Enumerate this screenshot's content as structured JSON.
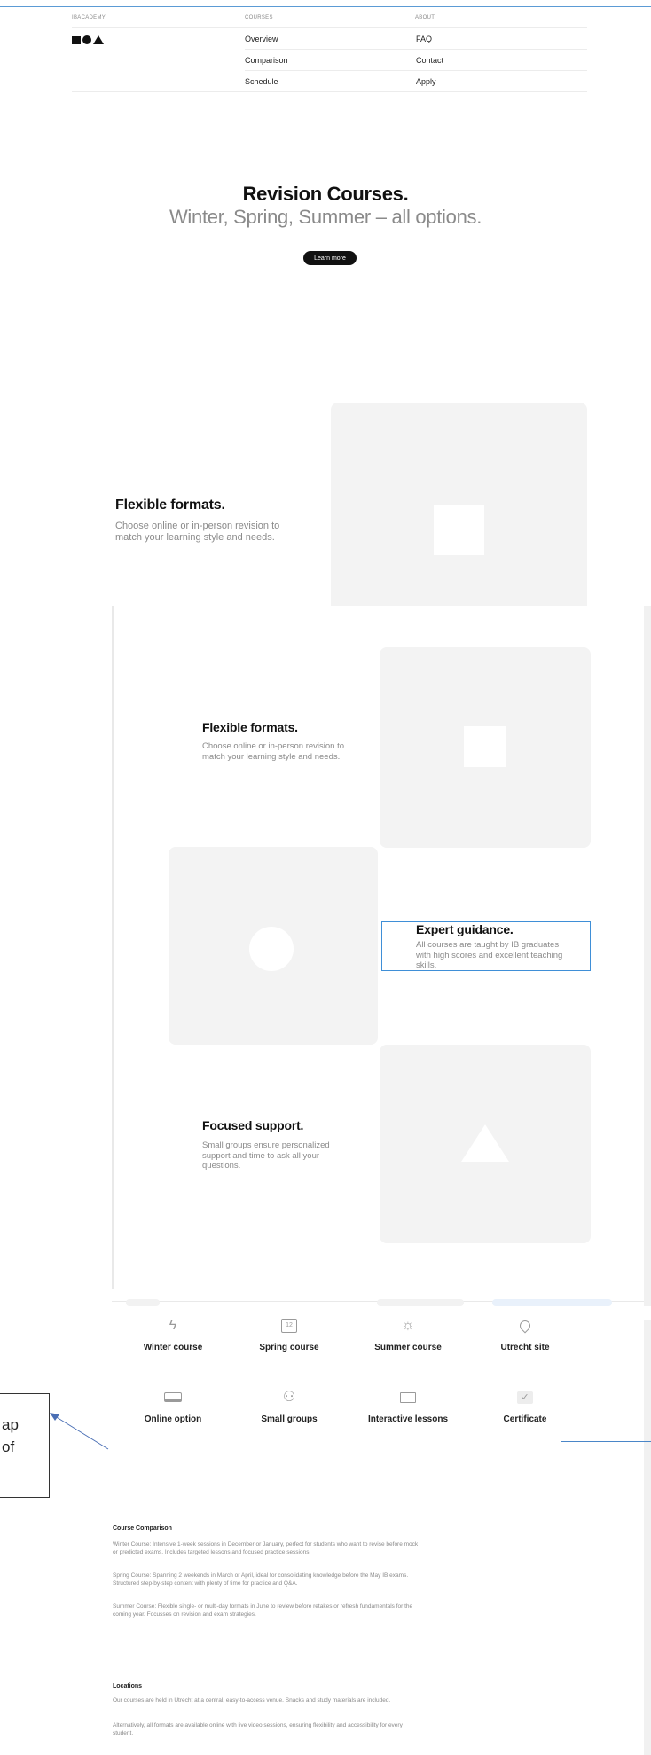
{
  "nav": {
    "brand_label": "IBACADEMY",
    "courses_label": "COURSES",
    "about_label": "ABOUT",
    "courses_links": [
      "Overview",
      "Comparison",
      "Schedule"
    ],
    "about_links": [
      "FAQ",
      "Contact",
      "Apply"
    ]
  },
  "hero": {
    "title": "Revision Courses.",
    "subtitle": "Winter, Spring, Summer – all options.",
    "cta_label": "Learn more"
  },
  "features_preview": {
    "title": "Flexible formats.",
    "description": "Choose online or in-person revision to match your learning style and needs."
  },
  "features": [
    {
      "title": "Flexible formats.",
      "description": "Choose online or in-person revision to match your learning style and needs.",
      "shape": "square"
    },
    {
      "title": "Expert guidance.",
      "description": "All courses are taught by IB graduates with high scores and excellent teaching skills.",
      "shape": "circle"
    },
    {
      "title": "Focused support.",
      "description": "Small groups ensure personalized support and time to ask all your questions.",
      "shape": "triangle"
    }
  ],
  "offerings": [
    {
      "label": "Winter course",
      "icon": "lightning-icon"
    },
    {
      "label": "Spring course",
      "icon": "calendar-icon",
      "icon_text": "12"
    },
    {
      "label": "Summer course",
      "icon": "sun-icon"
    },
    {
      "label": "Utrecht site",
      "icon": "location-pin-icon"
    },
    {
      "label": "Online option",
      "icon": "laptop-icon"
    },
    {
      "label": "Small groups",
      "icon": "people-icon"
    },
    {
      "label": "Interactive lessons",
      "icon": "presentation-icon"
    },
    {
      "label": "Certificate",
      "icon": "checkmark-icon"
    }
  ],
  "callout": {
    "line1": "ap",
    "line2": "of"
  },
  "comparison": {
    "heading": "Course Comparison",
    "paragraphs": [
      "Winter Course: Intensive 1-week sessions in December or January, perfect for students who want to revise before mock or predicted exams. Includes targeted lessons and focused practice sessions.",
      "Spring Course: Spanning 2 weekends in March or April, ideal for consolidating knowledge before the May IB exams. Structured step-by-step content with plenty of time for practice and Q&A.",
      "Summer Course: Flexible single- or multi-day formats in June to review before retakes or refresh fundamentals for the coming year. Focusses on revision and exam strategies."
    ]
  },
  "locations": {
    "heading": "Locations",
    "paragraphs": [
      "Our courses are held in Utrecht at a central, easy-to-access venue. Snacks and study materials are included.",
      "Alternatively, all formats are available online with live video sessions, ensuring flexibility and accessibility for every student."
    ]
  },
  "colors": {
    "accent_blue": "#3f8fd7",
    "card_bg": "#f3f3f3",
    "muted_text": "#8a8a8a"
  }
}
